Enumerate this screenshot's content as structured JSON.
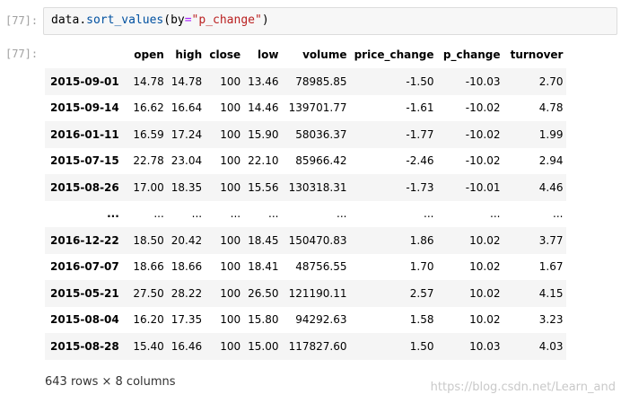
{
  "cell": {
    "input_prompt": "[77]:",
    "output_prompt": "[77]:",
    "code": {
      "obj": "data",
      "dot": ".",
      "method": "sort_values",
      "open_paren": "(",
      "kwarg": "by",
      "eq": "=",
      "value": "\"p_change\"",
      "close_paren": ")"
    }
  },
  "table": {
    "columns": [
      "open",
      "high",
      "close",
      "low",
      "volume",
      "price_change",
      "p_change",
      "turnover"
    ],
    "rows": [
      {
        "index": "2015-09-01",
        "cells": [
          "14.78",
          "14.78",
          "100",
          "13.46",
          "78985.85",
          "-1.50",
          "-10.03",
          "2.70"
        ]
      },
      {
        "index": "2015-09-14",
        "cells": [
          "16.62",
          "16.64",
          "100",
          "14.46",
          "139701.77",
          "-1.61",
          "-10.02",
          "4.78"
        ]
      },
      {
        "index": "2016-01-11",
        "cells": [
          "16.59",
          "17.24",
          "100",
          "15.90",
          "58036.37",
          "-1.77",
          "-10.02",
          "1.99"
        ]
      },
      {
        "index": "2015-07-15",
        "cells": [
          "22.78",
          "23.04",
          "100",
          "22.10",
          "85966.42",
          "-2.46",
          "-10.02",
          "2.94"
        ]
      },
      {
        "index": "2015-08-26",
        "cells": [
          "17.00",
          "18.35",
          "100",
          "15.56",
          "130318.31",
          "-1.73",
          "-10.01",
          "4.46"
        ]
      },
      {
        "index": "...",
        "cells": [
          "...",
          "...",
          "...",
          "...",
          "...",
          "...",
          "...",
          "..."
        ]
      },
      {
        "index": "2016-12-22",
        "cells": [
          "18.50",
          "20.42",
          "100",
          "18.45",
          "150470.83",
          "1.86",
          "10.02",
          "3.77"
        ]
      },
      {
        "index": "2016-07-07",
        "cells": [
          "18.66",
          "18.66",
          "100",
          "18.41",
          "48756.55",
          "1.70",
          "10.02",
          "1.67"
        ]
      },
      {
        "index": "2015-05-21",
        "cells": [
          "27.50",
          "28.22",
          "100",
          "26.50",
          "121190.11",
          "2.57",
          "10.02",
          "4.15"
        ]
      },
      {
        "index": "2015-08-04",
        "cells": [
          "16.20",
          "17.35",
          "100",
          "15.80",
          "94292.63",
          "1.58",
          "10.02",
          "3.23"
        ]
      },
      {
        "index": "2015-08-28",
        "cells": [
          "15.40",
          "16.46",
          "100",
          "15.00",
          "117827.60",
          "1.50",
          "10.03",
          "4.03"
        ]
      }
    ]
  },
  "footer": {
    "shape": "643 rows × 8 columns"
  },
  "watermark": "https://blog.csdn.net/Learn_and"
}
